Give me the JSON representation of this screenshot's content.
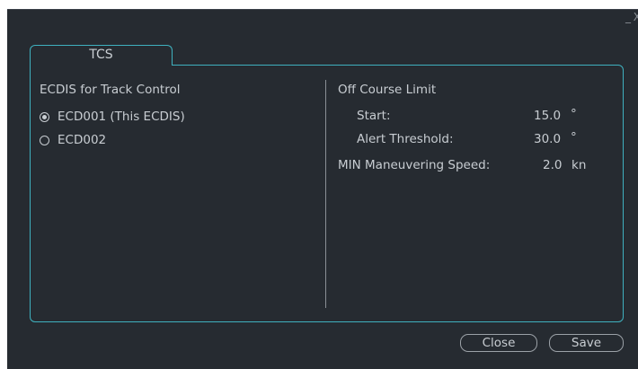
{
  "window": {
    "minimize_symbol": "_",
    "close_symbol": "X"
  },
  "tab": {
    "label": "TCS"
  },
  "left": {
    "heading": "ECDIS for Track Control",
    "options": [
      {
        "label": "ECD001 (This ECDIS)",
        "selected": true
      },
      {
        "label": "ECD002",
        "selected": false
      }
    ]
  },
  "right": {
    "off_course_heading": "Off Course Limit",
    "start_label": "Start:",
    "start_value": "15.0",
    "start_unit": "°",
    "alert_label": "Alert Threshold:",
    "alert_value": "30.0",
    "alert_unit": "°",
    "min_speed_label": "MIN Maneuvering Speed:",
    "min_speed_value": "2.0",
    "min_speed_unit": "kn"
  },
  "buttons": {
    "close": "Close",
    "save": "Save"
  },
  "colors": {
    "background": "#262b31",
    "accent": "#3fb1bf",
    "text": "#c8cdd2"
  }
}
